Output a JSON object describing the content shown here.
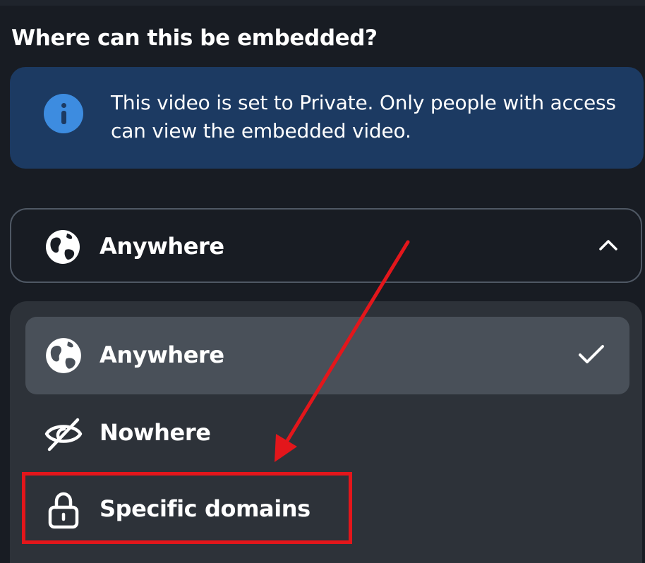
{
  "heading": "Where can this be embedded?",
  "info_banner": {
    "icon": "info-icon",
    "text": "This video is set to Private. Only people with access can view the embedded video."
  },
  "select": {
    "selected_label": "Anywhere",
    "icon": "globe-icon",
    "expanded": true,
    "toggle_icon": "chevron-up-icon"
  },
  "menu": {
    "items": [
      {
        "label": "Anywhere",
        "icon": "globe-icon",
        "selected": true
      },
      {
        "label": "Nowhere",
        "icon": "eye-slash-icon",
        "selected": false
      },
      {
        "label": "Specific domains",
        "icon": "lock-icon",
        "selected": false
      }
    ]
  },
  "annotation": {
    "arrow_color": "#e3161b",
    "highlight_color": "#e3161b"
  },
  "colors": {
    "background": "#181c23",
    "banner": "#1c3a62",
    "info_icon": "#3d8ce0",
    "menu": "#2d3239",
    "selected_item": "#495059"
  }
}
